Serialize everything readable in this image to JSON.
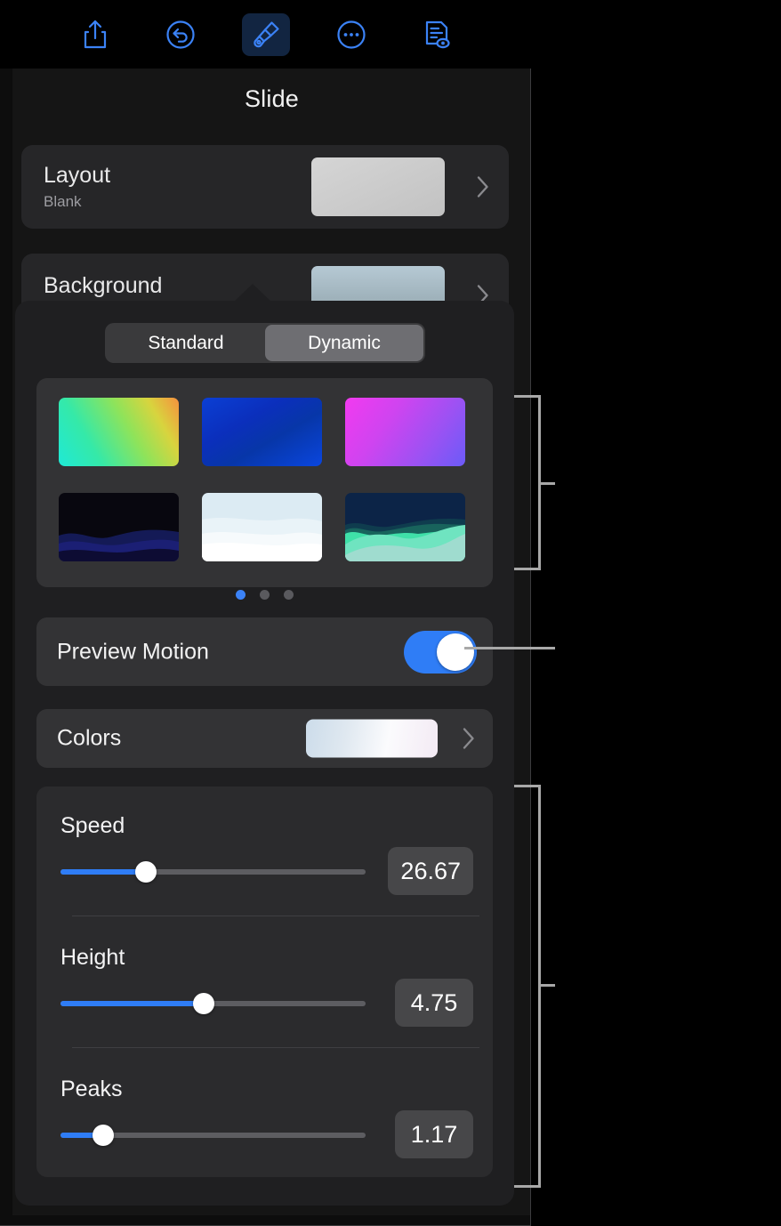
{
  "toolbar": {
    "items": [
      {
        "name": "share-icon",
        "label": "Share"
      },
      {
        "name": "undo-icon",
        "label": "Undo"
      },
      {
        "name": "brush-icon",
        "label": "Format",
        "active": true
      },
      {
        "name": "ellipsis-icon",
        "label": "More"
      },
      {
        "name": "document-icon",
        "label": "Document Options"
      }
    ]
  },
  "panel": {
    "title": "Slide"
  },
  "rows": {
    "layout": {
      "label": "Layout",
      "value": "Blank",
      "chevron": "chevron-right-icon"
    },
    "background": {
      "label": "Background",
      "chevron": "chevron-right-icon"
    }
  },
  "popover": {
    "segmented": {
      "options": [
        "Standard",
        "Dynamic"
      ],
      "selected": "Dynamic"
    },
    "backgrounds": [
      {
        "name": "cyan-green-orange-gradient"
      },
      {
        "name": "deep-blue-gradient"
      },
      {
        "name": "magenta-purple-gradient"
      },
      {
        "name": "dark-night-mountains"
      },
      {
        "name": "white-mist-landscape"
      },
      {
        "name": "teal-mint-dunes"
      }
    ],
    "pager": {
      "count": 3,
      "active_index": 0
    },
    "preview_motion": {
      "label": "Preview Motion",
      "enabled": true,
      "state_text": "On"
    },
    "colors": {
      "label": "Colors",
      "chevron": "chevron-right-icon"
    },
    "sliders": [
      {
        "label": "Speed",
        "value": "26.67",
        "percent": 28
      },
      {
        "label": "Height",
        "value": "4.75",
        "percent": 47
      },
      {
        "label": "Peaks",
        "value": "1.17",
        "percent": 14
      }
    ]
  },
  "colors": {
    "accent": "#2f7df6",
    "toolbar_icon": "#3b82f6",
    "toolbar_active_bg": "#122541",
    "panel_bg": "#151515",
    "popover_bg": "#1f1f21",
    "card_bg": "#333335",
    "track": "#5d5d61",
    "callout": "#a8a8a8"
  },
  "callouts": [
    {
      "name": "callout-backgrounds"
    },
    {
      "name": "callout-preview-motion"
    },
    {
      "name": "callout-sliders"
    }
  ]
}
